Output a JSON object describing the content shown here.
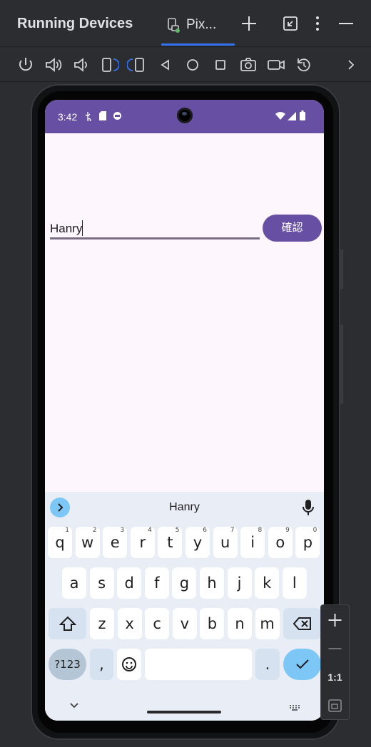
{
  "window": {
    "title": "Running Devices",
    "tab_label": "Pix...",
    "accent": "#3574f0"
  },
  "toolbar": {
    "icons": [
      "power-icon",
      "volume-up-icon",
      "volume-down-icon",
      "rotate-left-icon",
      "rotate-right-icon",
      "back-icon",
      "home-icon",
      "overview-icon",
      "screenshot-icon",
      "screen-record-icon",
      "reset-icon",
      "chevron-right-icon"
    ]
  },
  "device": {
    "status_bar": {
      "time": "3:42",
      "color": "#6750a4"
    },
    "app": {
      "name_input": {
        "value": "Hanry"
      },
      "confirm_button": {
        "label": "確認",
        "color": "#6750a4"
      }
    },
    "keyboard": {
      "suggestion": "Hanry",
      "row1": [
        {
          "key": "q",
          "hint": "1"
        },
        {
          "key": "w",
          "hint": "2"
        },
        {
          "key": "e",
          "hint": "3"
        },
        {
          "key": "r",
          "hint": "4"
        },
        {
          "key": "t",
          "hint": "5"
        },
        {
          "key": "y",
          "hint": "6"
        },
        {
          "key": "u",
          "hint": "7"
        },
        {
          "key": "i",
          "hint": "8"
        },
        {
          "key": "o",
          "hint": "9"
        },
        {
          "key": "p",
          "hint": "0"
        }
      ],
      "row2": [
        "a",
        "s",
        "d",
        "f",
        "g",
        "h",
        "j",
        "k",
        "l"
      ],
      "row3": [
        "z",
        "x",
        "c",
        "v",
        "b",
        "n",
        "m"
      ],
      "symbols_label": "?123",
      "comma": ",",
      "period": ".",
      "accent": "#7dc7f7"
    }
  },
  "zoom_panel": {
    "one_to_one_label": "1:1"
  }
}
